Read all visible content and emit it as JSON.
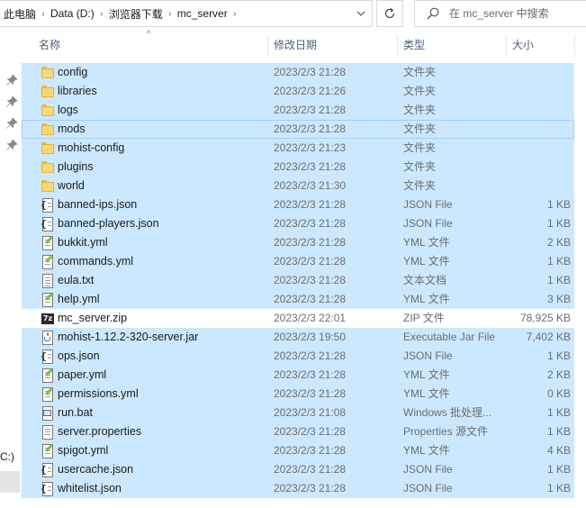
{
  "address": {
    "crumbs": [
      "此电脑",
      "Data (D:)",
      "浏览器下载",
      "mc_server"
    ]
  },
  "search": {
    "placeholder": "在 mc_server 中搜索"
  },
  "nav": {
    "drive_label": "C:)"
  },
  "columns": {
    "name": "名称",
    "date": "修改日期",
    "type": "类型",
    "size": "大小"
  },
  "files": [
    {
      "name": "config",
      "date": "2023/2/3 21:28",
      "type": "文件夹",
      "size": "",
      "icon": "folder-icon",
      "state": "sel"
    },
    {
      "name": "libraries",
      "date": "2023/2/3 21:26",
      "type": "文件夹",
      "size": "",
      "icon": "folder-icon",
      "state": "sel"
    },
    {
      "name": "logs",
      "date": "2023/2/3 21:28",
      "type": "文件夹",
      "size": "",
      "icon": "folder-icon",
      "state": "sel"
    },
    {
      "name": "mods",
      "date": "2023/2/3 21:28",
      "type": "文件夹",
      "size": "",
      "icon": "folder-icon",
      "state": "focus"
    },
    {
      "name": "mohist-config",
      "date": "2023/2/3 21:23",
      "type": "文件夹",
      "size": "",
      "icon": "folder-icon",
      "state": "sel"
    },
    {
      "name": "plugins",
      "date": "2023/2/3 21:28",
      "type": "文件夹",
      "size": "",
      "icon": "folder-icon",
      "state": "sel"
    },
    {
      "name": "world",
      "date": "2023/2/3 21:30",
      "type": "文件夹",
      "size": "",
      "icon": "folder-icon",
      "state": "sel"
    },
    {
      "name": "banned-ips.json",
      "date": "2023/2/3 21:28",
      "type": "JSON File",
      "size": "1 KB",
      "icon": "json-file-icon",
      "state": "sel"
    },
    {
      "name": "banned-players.json",
      "date": "2023/2/3 21:28",
      "type": "JSON File",
      "size": "1 KB",
      "icon": "json-file-icon",
      "state": "sel"
    },
    {
      "name": "bukkit.yml",
      "date": "2023/2/3 21:28",
      "type": "YML 文件",
      "size": "2 KB",
      "icon": "yml-file-icon",
      "state": "sel"
    },
    {
      "name": "commands.yml",
      "date": "2023/2/3 21:28",
      "type": "YML 文件",
      "size": "1 KB",
      "icon": "yml-file-icon",
      "state": "sel"
    },
    {
      "name": "eula.txt",
      "date": "2023/2/3 21:28",
      "type": "文本文档",
      "size": "1 KB",
      "icon": "text-file-icon",
      "state": "sel"
    },
    {
      "name": "help.yml",
      "date": "2023/2/3 21:28",
      "type": "YML 文件",
      "size": "3 KB",
      "icon": "yml-file-icon",
      "state": "sel"
    },
    {
      "name": "mc_server.zip",
      "date": "2023/2/3 22:01",
      "type": "ZIP 文件",
      "size": "78,925 KB",
      "icon": "zip-file-icon",
      "state": "none"
    },
    {
      "name": "mohist-1.12.2-320-server.jar",
      "date": "2023/2/3 19:50",
      "type": "Executable Jar File",
      "size": "7,402 KB",
      "icon": "jar-file-icon",
      "state": "sel"
    },
    {
      "name": "ops.json",
      "date": "2023/2/3 21:28",
      "type": "JSON File",
      "size": "1 KB",
      "icon": "json-file-icon",
      "state": "sel"
    },
    {
      "name": "paper.yml",
      "date": "2023/2/3 21:28",
      "type": "YML 文件",
      "size": "2 KB",
      "icon": "yml-file-icon",
      "state": "sel"
    },
    {
      "name": "permissions.yml",
      "date": "2023/2/3 21:28",
      "type": "YML 文件",
      "size": "0 KB",
      "icon": "yml-file-icon",
      "state": "sel"
    },
    {
      "name": "run.bat",
      "date": "2023/2/3 21:08",
      "type": "Windows 批处理...",
      "size": "1 KB",
      "icon": "bat-file-icon",
      "state": "sel"
    },
    {
      "name": "server.properties",
      "date": "2023/2/3 21:28",
      "type": "Properties 源文件",
      "size": "1 KB",
      "icon": "properties-file-icon",
      "state": "sel"
    },
    {
      "name": "spigot.yml",
      "date": "2023/2/3 21:28",
      "type": "YML 文件",
      "size": "4 KB",
      "icon": "yml-file-icon",
      "state": "sel"
    },
    {
      "name": "usercache.json",
      "date": "2023/2/3 21:28",
      "type": "JSON File",
      "size": "1 KB",
      "icon": "json-file-icon",
      "state": "sel"
    },
    {
      "name": "whitelist.json",
      "date": "2023/2/3 21:28",
      "type": "JSON File",
      "size": "1 KB",
      "icon": "json-file-icon",
      "state": "sel"
    }
  ]
}
